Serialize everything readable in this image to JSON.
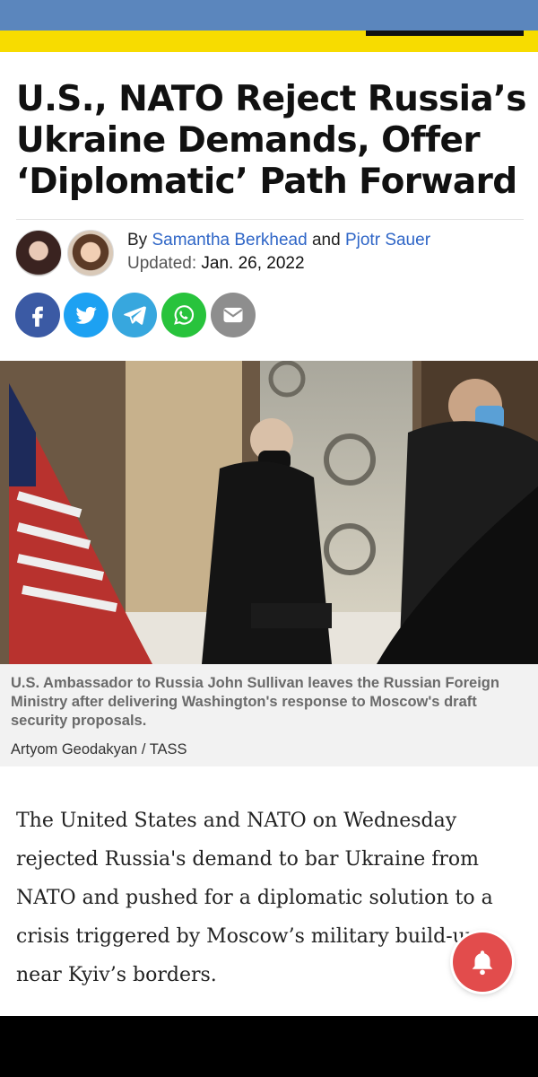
{
  "article": {
    "headline": "U.S., NATO Reject Russia’s Ukraine Demands, Offer ‘Diplomatic’ Path Forward",
    "byline_prefix": "By",
    "author1": "Samantha Berkhead",
    "byline_and": "and",
    "author2": "Pjotr Sauer",
    "updated_label": "Updated:",
    "updated_date": "Jan. 26, 2022",
    "caption": "U.S. Ambassador to Russia John Sullivan leaves the Russian Foreign Ministry after delivering Washington's response to Moscow's draft security proposals.",
    "photo_credit": "Artyom Geodakyan / TASS",
    "body": "The United States and NATO on Wednesday rejected Russia's demand to bar Ukraine from NATO and pushed for a diplomatic solution to a crisis triggered by Moscow’s military build-up near Kyiv’s borders."
  },
  "share": {
    "icons": [
      "facebook-icon",
      "twitter-icon",
      "telegram-icon",
      "whatsapp-icon",
      "email-icon"
    ]
  },
  "colors": {
    "top_blue": "#5b86bd",
    "top_yellow": "#f7dc00",
    "author_link": "#2f66c7",
    "notification_bell": "#e24c4c"
  }
}
